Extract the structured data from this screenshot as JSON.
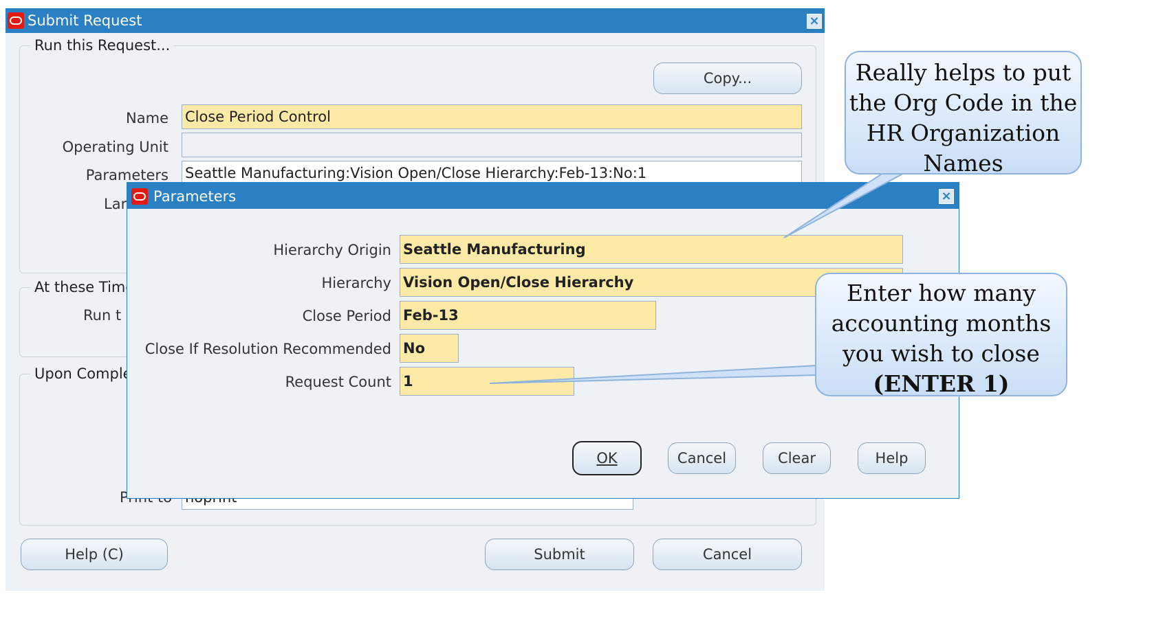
{
  "submit_request": {
    "title": "Submit Request",
    "run_group_label": "Run this Request...",
    "copy_label": "Copy...",
    "name_label": "Name",
    "name_value": "Close Period Control",
    "ou_label": "Operating Unit",
    "ou_value": "",
    "params_label": "Parameters",
    "params_value": "Seattle Manufacturing:Vision Open/Close Hierarchy:Feb-13:No:1",
    "language_label_partial": "Lar",
    "times_group_label": "At these Times",
    "run_label_partial": "Run t",
    "completion_group_label": "Upon Completion",
    "print_to_label": "Print to",
    "print_to_value": "noprint",
    "help_label": "Help (C)",
    "submit_label": "Submit",
    "cancel_label": "Cancel"
  },
  "parameters": {
    "title": "Parameters",
    "fields": [
      {
        "label": "Hierarchy Origin",
        "value": "Seattle Manufacturing"
      },
      {
        "label": "Hierarchy",
        "value": "Vision Open/Close Hierarchy"
      },
      {
        "label": "Close Period",
        "value": "Feb-13"
      },
      {
        "label": "Close If Resolution Recommended",
        "value": "No"
      },
      {
        "label": "Request Count",
        "value": "1"
      }
    ],
    "ok_label": "OK",
    "cancel_label": "Cancel",
    "clear_label": "Clear",
    "help_label": "Help"
  },
  "callouts": {
    "org_code_tip": [
      "Really helps to put",
      "the Org Code in the",
      "HR Organization",
      "Names"
    ],
    "request_count_tip": [
      "Enter how many",
      "accounting months",
      "you wish to close",
      "(ENTER 1)"
    ]
  },
  "colors": {
    "titlebar": "#2a80c3",
    "required_field": "#fdeaa7",
    "oracle_red": "#e21b12"
  }
}
